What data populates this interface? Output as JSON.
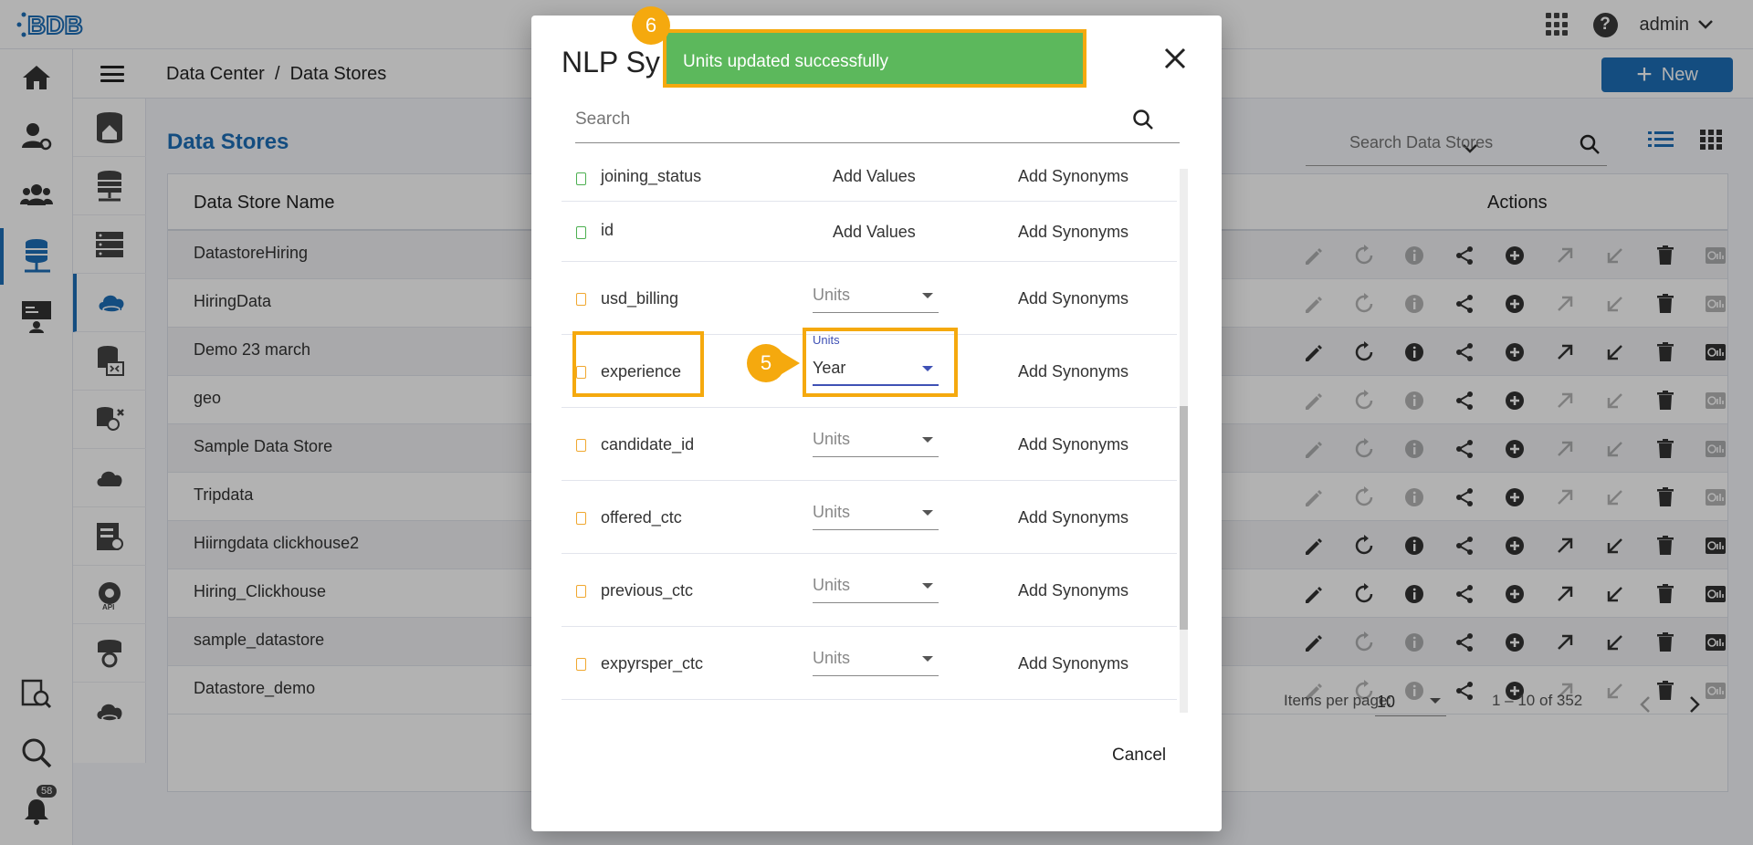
{
  "header": {
    "logo_alt": "BDB",
    "user": "admin"
  },
  "breadcrumb": "Data Center  /  Data Stores",
  "new_button": "New",
  "page_title": "Data Stores",
  "search": {
    "placeholder": "Search Data Stores"
  },
  "table": {
    "col_name": "Data Store Name",
    "col_actions": "Actions",
    "rows": [
      {
        "name": "DatastoreHiring"
      },
      {
        "name": "HiringData"
      },
      {
        "name": "Demo 23 march"
      },
      {
        "name": "geo"
      },
      {
        "name": "Sample Data Store"
      },
      {
        "name": "Tripdata"
      },
      {
        "name": "Hiirngdata clickhouse2"
      },
      {
        "name": "Hiring_Clickhouse"
      },
      {
        "name": "sample_datastore"
      },
      {
        "name": "Datastore_demo"
      }
    ]
  },
  "pagination": {
    "items_per_page_label": "Items per page:",
    "items_per_page": "10",
    "range": "1 – 10 of 352"
  },
  "notifications": {
    "count": "58"
  },
  "modal": {
    "title": "NLP Sy",
    "search_placeholder": "Search",
    "rows": [
      {
        "column": "joining_status",
        "value": "Add Values",
        "synonyms": "Add Synonyms"
      },
      {
        "column": "id",
        "value": "Add Values",
        "synonyms": "Add Synonyms"
      },
      {
        "column": "usd_billing",
        "unit": "Units",
        "synonyms": "Add Synonyms"
      },
      {
        "column": "experience",
        "unit_label": "Units",
        "unit": "Year",
        "synonyms": "Add Synonyms"
      },
      {
        "column": "candidate_id",
        "unit": "Units",
        "synonyms": "Add Synonyms"
      },
      {
        "column": "offered_ctc",
        "unit": "Units",
        "synonyms": "Add Synonyms"
      },
      {
        "column": "previous_ctc",
        "unit": "Units",
        "synonyms": "Add Synonyms"
      },
      {
        "column": "expyrsper_ctc",
        "unit": "Units",
        "synonyms": "Add Synonyms"
      }
    ],
    "cancel": "Cancel"
  },
  "toast": {
    "message": "Units updated successfully"
  },
  "callouts": {
    "step5": "5",
    "step6": "6"
  },
  "colors": {
    "accent": "#1e6fb8",
    "highlight": "#f5a90e",
    "toast": "#5cb85c"
  }
}
